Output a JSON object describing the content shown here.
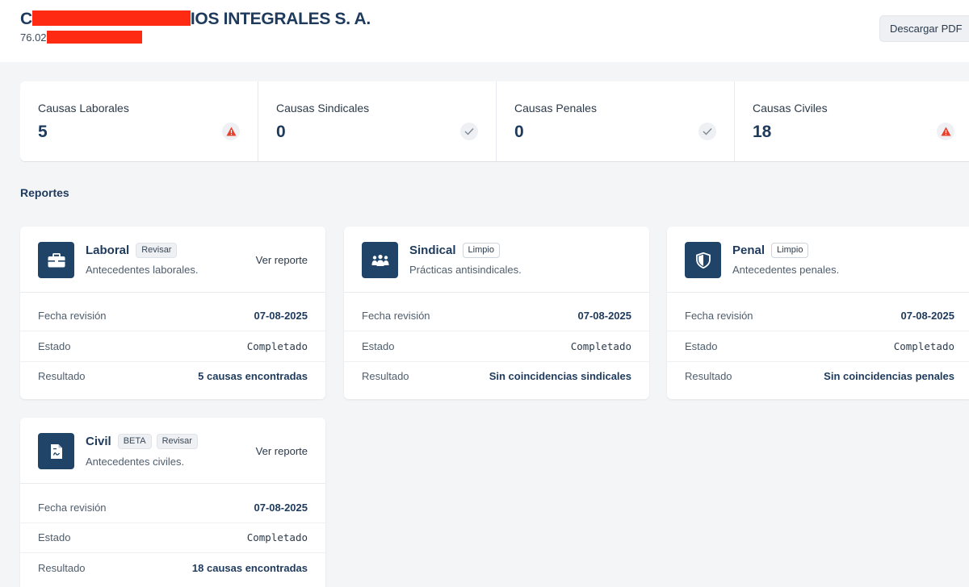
{
  "header": {
    "title_lead": "C",
    "title_visible": "IOS INTEGRALES S. A.",
    "rut_visible": "76.02",
    "download_button": "Descargar PDF"
  },
  "stats": [
    {
      "label": "Causas Laborales",
      "value": "5",
      "status_icon": "warning-icon"
    },
    {
      "label": "Causas Sindicales",
      "value": "0",
      "status_icon": "check-icon"
    },
    {
      "label": "Causas Penales",
      "value": "0",
      "status_icon": "check-icon"
    },
    {
      "label": "Causas Civiles",
      "value": "18",
      "status_icon": "warning-icon"
    }
  ],
  "reports_title": "Reportes",
  "row_labels": {
    "date": "Fecha revisión",
    "status": "Estado",
    "result": "Resultado"
  },
  "cards": [
    {
      "title": "Laboral",
      "badges": [
        "Revisar"
      ],
      "subtitle": "Antecedentes laborales.",
      "link": "Ver reporte",
      "icon": "briefcase-icon",
      "date": "07-08-2025",
      "status": "Completado",
      "result": "5 causas encontradas"
    },
    {
      "title": "Sindical",
      "badges": [
        "Limpio"
      ],
      "subtitle": "Prácticas antisindicales.",
      "link": "",
      "icon": "group-icon",
      "date": "07-08-2025",
      "status": "Completado",
      "result": "Sin coincidencias sindicales"
    },
    {
      "title": "Penal",
      "badges": [
        "Limpio"
      ],
      "subtitle": "Antecedentes penales.",
      "link": "",
      "icon": "shield-icon",
      "date": "07-08-2025",
      "status": "Completado",
      "result": "Sin coincidencias penales"
    },
    {
      "title": "Civil",
      "badges": [
        "BETA",
        "Revisar"
      ],
      "subtitle": "Antecedentes civiles.",
      "link": "Ver reporte",
      "icon": "document-icon",
      "date": "07-08-2025",
      "status": "Completado",
      "result": "18 causas encontradas"
    }
  ],
  "colors": {
    "accent": "#1f4468",
    "warning": "#e8402a",
    "redaction": "#ff2a12"
  }
}
